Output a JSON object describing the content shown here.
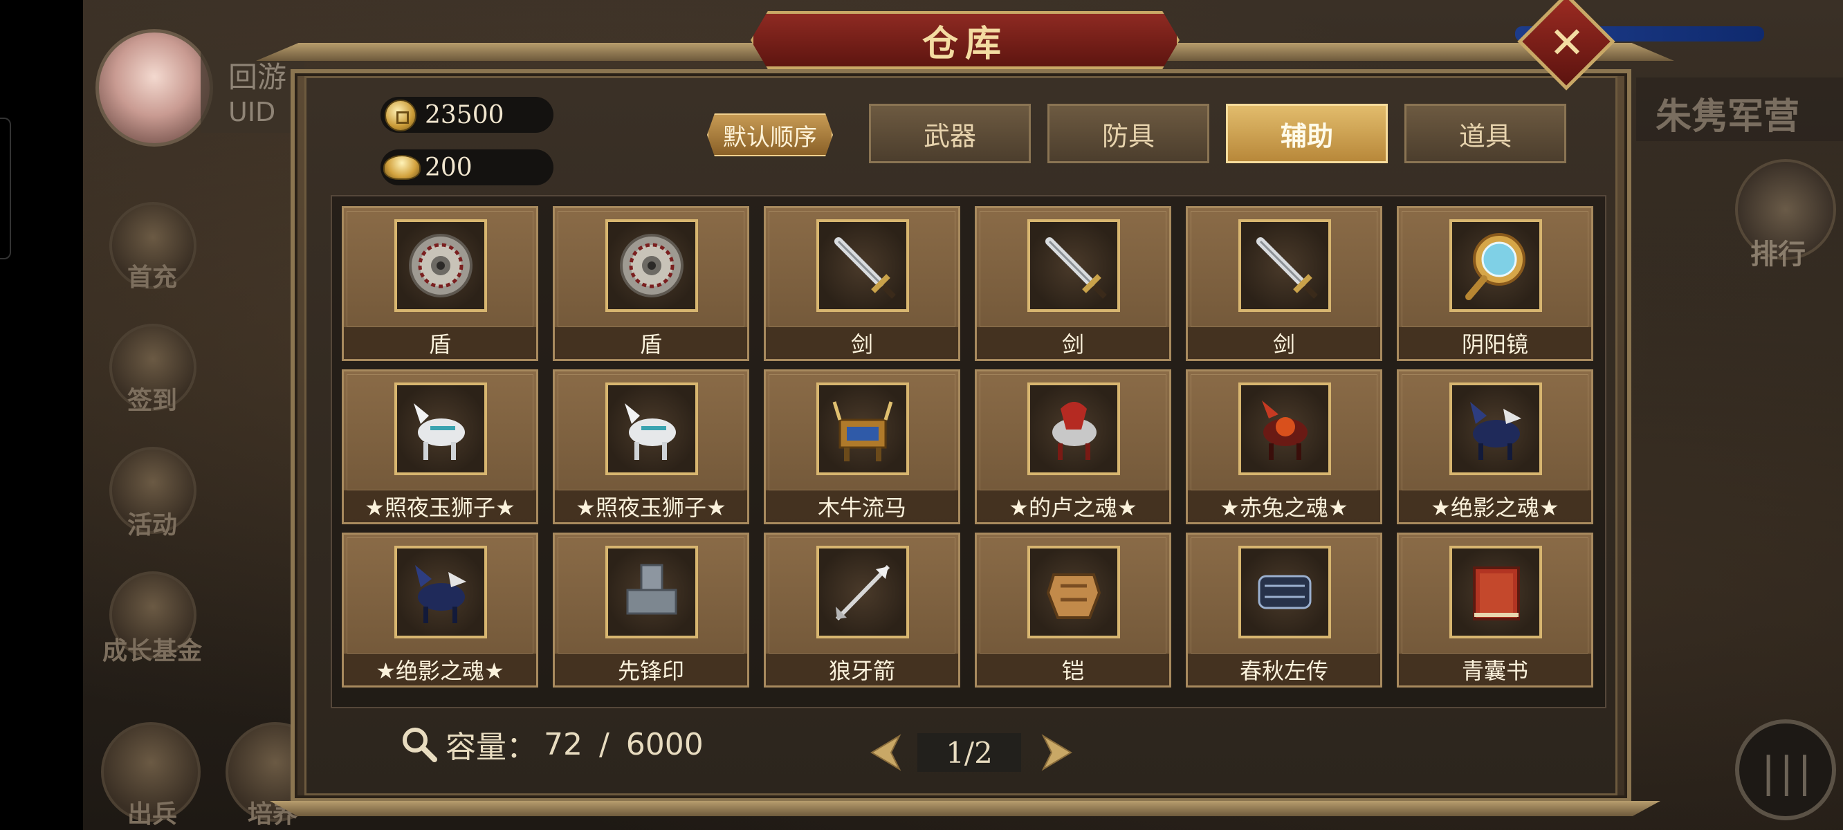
{
  "player": {
    "name": "回游",
    "uid_label": "UID"
  },
  "side_menu": {
    "first_recharge": "首充",
    "sign_in": "签到",
    "activity": "活动",
    "growth_fund": "成长基金",
    "dispatch": "出兵",
    "train": "培养"
  },
  "right_panel": {
    "camp": "朱隽军营",
    "ranking": "排行"
  },
  "window": {
    "title": "仓库"
  },
  "currency": {
    "coins": "23500",
    "ingots": "200"
  },
  "sort_label": "默认顺序",
  "tabs": [
    {
      "label": "武器",
      "active": false
    },
    {
      "label": "防具",
      "active": false
    },
    {
      "label": "辅助",
      "active": true
    },
    {
      "label": "道具",
      "active": false
    }
  ],
  "items": [
    {
      "name": "盾",
      "icon": "shield-icon"
    },
    {
      "name": "盾",
      "icon": "shield-icon"
    },
    {
      "name": "剑",
      "icon": "sword-icon"
    },
    {
      "name": "剑",
      "icon": "sword-icon"
    },
    {
      "name": "剑",
      "icon": "sword-icon"
    },
    {
      "name": "阴阳镜",
      "icon": "mirror-icon"
    },
    {
      "name": "★照夜玉狮子★",
      "icon": "white-horse-icon"
    },
    {
      "name": "★照夜玉狮子★",
      "icon": "white-horse-icon"
    },
    {
      "name": "木牛流马",
      "icon": "wooden-ox-icon"
    },
    {
      "name": "★的卢之魂★",
      "icon": "red-horse-icon"
    },
    {
      "name": "★赤兔之魂★",
      "icon": "red-hare-icon"
    },
    {
      "name": "★绝影之魂★",
      "icon": "dark-horse-icon"
    },
    {
      "name": "★绝影之魂★",
      "icon": "dark-horse-icon"
    },
    {
      "name": "先锋印",
      "icon": "seal-icon"
    },
    {
      "name": "狼牙箭",
      "icon": "arrow-icon"
    },
    {
      "name": "铠",
      "icon": "armor-icon"
    },
    {
      "name": "春秋左传",
      "icon": "scroll-icon"
    },
    {
      "name": "青囊书",
      "icon": "book-icon"
    }
  ],
  "capacity": {
    "label": "容量：",
    "used": "72",
    "separator": " / ",
    "total": "6000"
  },
  "pager": {
    "text": "1/2"
  }
}
